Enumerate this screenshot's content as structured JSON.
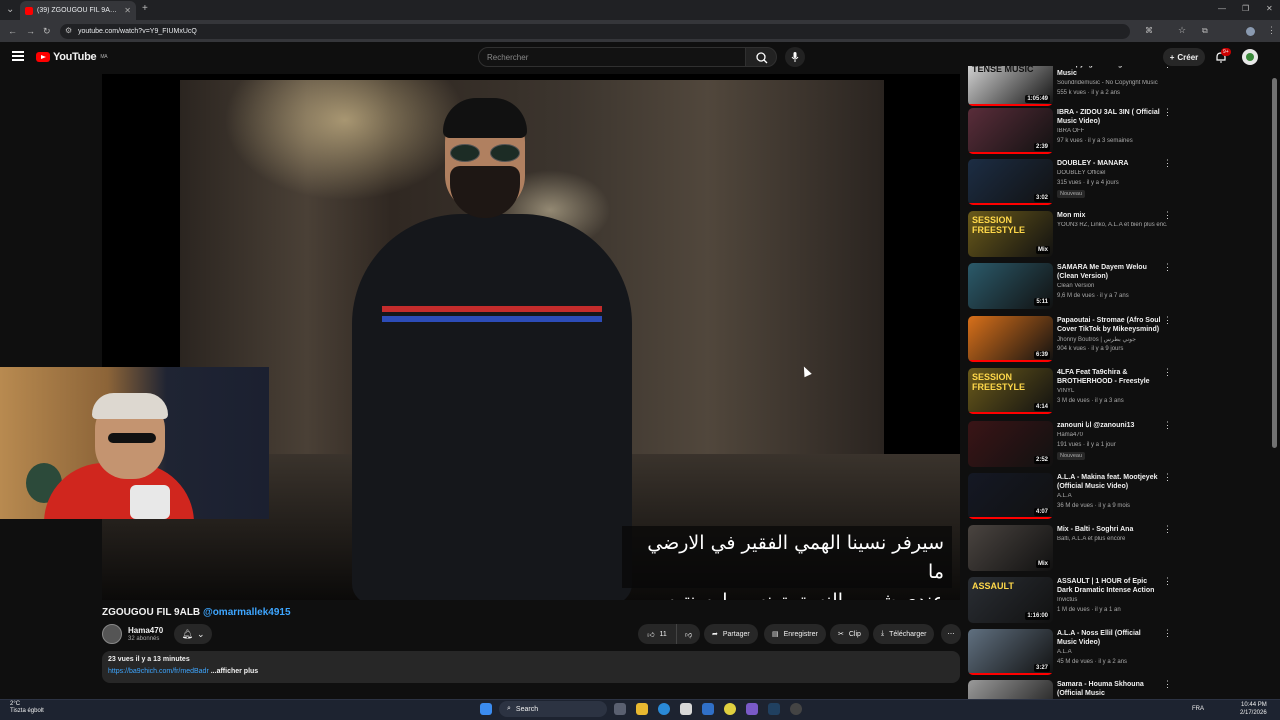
{
  "browser": {
    "tab_title": "(39) ZGOUGOU FIL 9ALB @om",
    "url": "youtube.com/watch?v=Y9_FIUMxUcQ"
  },
  "header": {
    "logo_text": "YouTube",
    "logo_sup": "MA",
    "search_placeholder": "Rechercher",
    "create_label": "Créer",
    "notif_count": "9+"
  },
  "video": {
    "subtitle_line1": "سيرفر نسينا الهمي الفقير في الارضي ما",
    "subtitle_line2": "عندي شويه بالنسق تونس ولوسنتوس",
    "title": "ZGOUGOU FIL 9ALB",
    "title_mention": "@omarmallek4915",
    "channel": "Hama470",
    "subscribers": "32 abonnés",
    "likes": "11",
    "share": "Partager",
    "save": "Enregistrer",
    "clip": "Clip",
    "download": "Télécharger",
    "desc_stats": "23 vues  il y a 13 minutes",
    "desc_link": "https://ba9chich.com/fr/medBadr",
    "desc_more": "...afficher plus"
  },
  "sidebar": {
    "items": [
      {
        "title": "NoCopyright Background Music",
        "channel": "Soundridemusic - No Copyright Music",
        "meta": "555 k vues · il y a 2 ans",
        "duration": "1:05:49",
        "thumb_text": "TENSE MUSIC",
        "color": "#d8d8d8",
        "progress": 1
      },
      {
        "title": "IBRA - ZIDOU 3AL 3IN ( Official Music Video)",
        "channel": "IBRA OFF",
        "meta": "97 k vues · il y a 3 semaines",
        "duration": "2:39",
        "thumb_text": "",
        "color": "#5a2d3a",
        "progress": 1
      },
      {
        "title": "DOUBLEY - MANARA",
        "channel": "DOUBLEY Officiel",
        "meta": "315 vues · il y a 4 jours",
        "badge": "Nouveau",
        "duration": "3:02",
        "thumb_text": "",
        "color": "#1c2d44",
        "progress": 1
      },
      {
        "title": "Mon mix",
        "channel": "YOUN3 RZ, Linko, A.L.A et bien plus enc...",
        "meta": "",
        "duration": "Mix",
        "thumb_text": "SESSION FREESTYLE",
        "color": "#6a5a1a",
        "progress": 0
      },
      {
        "title": "SAMARA Me Dayem Welou (Clean Version)",
        "channel": "Clean Version",
        "meta": "9,6 M de vues · il y a 7 ans",
        "duration": "5:11",
        "thumb_text": "",
        "color": "#2b5a6a",
        "progress": 0
      },
      {
        "title": "Papaoutai - Stromae (Afro Soul Cover TikTok by Mikeeysmind)",
        "channel": "Jhonny Boutros | جوني بطرس",
        "meta": "904 k vues · il y a 9 jours",
        "duration": "6:39",
        "thumb_text": "",
        "color": "#d8701a",
        "progress": 1
      },
      {
        "title": "4LFA Feat Ta9chira & BROTHERHOOD - Freestyle",
        "channel": "VINYL",
        "meta": "3 M de vues · il y a 3 ans",
        "duration": "4:14",
        "thumb_text": "SESSION FREESTYLE",
        "color": "#6a5a1a",
        "progress": 1
      },
      {
        "title": "zanouni انا @zanouni13",
        "channel": "Hama470",
        "meta": "191 vues · il y a 1 jour",
        "badge": "Nouveau",
        "duration": "2:52",
        "thumb_text": "",
        "color": "#3a1416",
        "progress": 0
      },
      {
        "title": "A.L.A - Makina feat. Mootjeyek (Official Music Video)",
        "channel": "A.L.A",
        "meta": "36 M de vues · il y a 9 mois",
        "duration": "4:07",
        "thumb_text": "",
        "color": "#141824",
        "progress": 1
      },
      {
        "title": "Mix - Balti - Soghri Ana",
        "channel": "Balti, A.L.A et plus encore",
        "meta": "",
        "duration": "Mix",
        "thumb_text": "",
        "color": "#4a4440",
        "progress": 0
      },
      {
        "title": "ASSAULT | 1 HOUR of Epic Dark Dramatic Intense Action Music",
        "channel": "Invictus",
        "meta": "1 M de vues · il y a 1 an",
        "duration": "1:16:00",
        "thumb_text": "ASSAULT",
        "color": "#2a2e34",
        "progress": 0
      },
      {
        "title": "A.L.A - Noss Ellil (Official Music Video)",
        "channel": "A.L.A",
        "meta": "45 M de vues · il y a 2 ans",
        "duration": "3:27",
        "thumb_text": "",
        "color": "#607080",
        "progress": 1
      },
      {
        "title": "Samara - Houma Skhouna (Official Music",
        "channel": "",
        "meta": "",
        "duration": "",
        "thumb_text": "",
        "color": "#9a9a9a",
        "progress": 0
      }
    ]
  },
  "taskbar": {
    "weather_temp": "2°C",
    "weather_desc": "Tiszta égbolt",
    "search_label": "Search",
    "lang": "FRA",
    "time": "10:44 PM",
    "date": "2/17/2026"
  }
}
